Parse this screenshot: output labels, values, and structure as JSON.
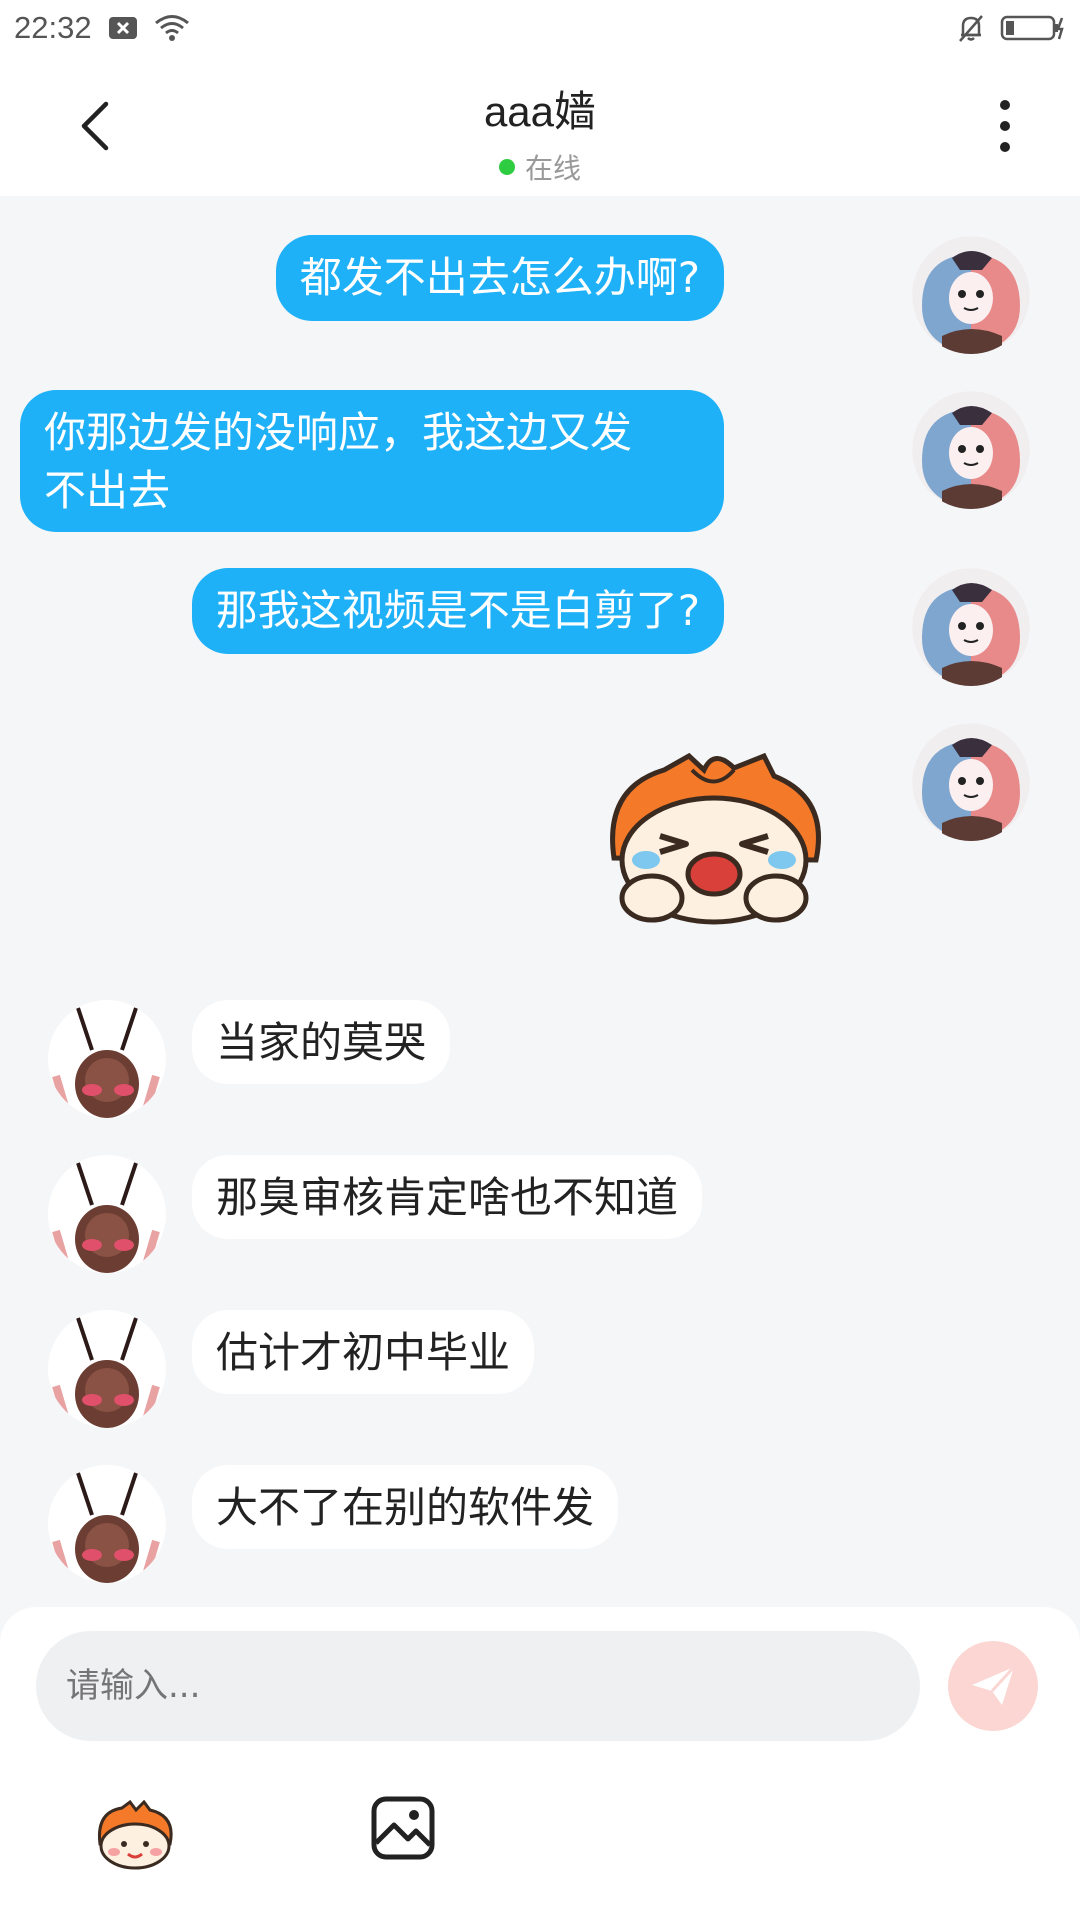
{
  "status_bar": {
    "time": "22:32",
    "icons": [
      "notification-x-icon",
      "wifi-icon",
      "mute-bell-icon",
      "battery-charging-icon"
    ]
  },
  "header": {
    "title": "aaa嫱",
    "status": "在线",
    "status_color": "#2ecc40",
    "back_icon": "chevron-left-icon",
    "more_icon": "more-vertical-icon"
  },
  "messages": [
    {
      "side": "out",
      "text": "都发不出去怎么办啊?"
    },
    {
      "side": "out",
      "text_line1": "你那边发的没响应，我这边又发",
      "text_line2": "不出去"
    },
    {
      "side": "out",
      "text": "那我这视频是不是白剪了?"
    },
    {
      "side": "out",
      "type": "sticker",
      "sticker": "crying-mascot-sticker"
    },
    {
      "side": "in",
      "text": "当家的莫哭"
    },
    {
      "side": "in",
      "text": "那臭审核肯定啥也不知道"
    },
    {
      "side": "in",
      "text": "估计才初中毕业"
    },
    {
      "side": "in",
      "text": "大不了在别的软件发"
    }
  ],
  "composer": {
    "placeholder": "请输入...",
    "send_icon": "paper-plane-icon",
    "tools": [
      "emoji-mascot-icon",
      "image-icon"
    ]
  },
  "colors": {
    "outgoing_bubble": "#1fb1f7",
    "incoming_bubble": "#ffffff",
    "background": "#f5f6f8",
    "send_button": "#fbd6d2"
  }
}
